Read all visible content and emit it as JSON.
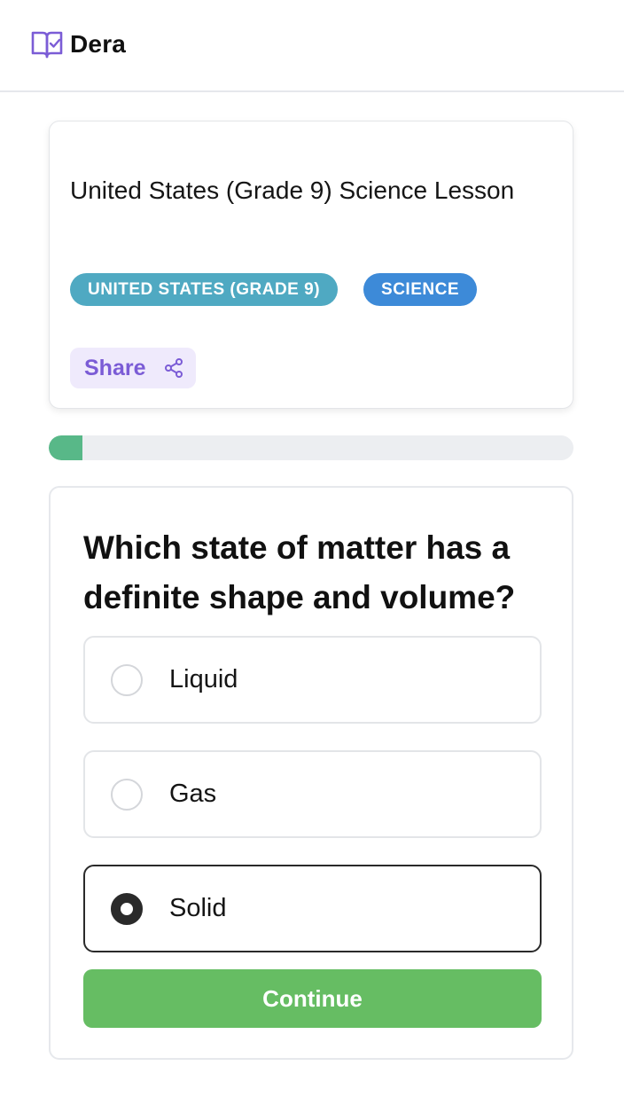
{
  "app": {
    "name": "Dera",
    "logo_icon": "book-check-icon",
    "brand_color": "#7b5cd6"
  },
  "lesson": {
    "title": "United States (Grade 9) Science Lesson",
    "tags": [
      {
        "label": "UNITED STATES (GRADE 9)",
        "color": "#4fa9c2"
      },
      {
        "label": "SCIENCE",
        "color": "#3d8ad8"
      }
    ],
    "share": {
      "label": "Share",
      "icon": "share-icon"
    }
  },
  "progress": {
    "fraction": 0.065,
    "color": "#58b888"
  },
  "quiz": {
    "question": "Which state of matter has a definite shape and volume?",
    "options": [
      {
        "label": "Liquid",
        "selected": false
      },
      {
        "label": "Gas",
        "selected": false
      },
      {
        "label": "Solid",
        "selected": true
      }
    ],
    "continue_label": "Continue",
    "continue_color": "#66bd63"
  }
}
